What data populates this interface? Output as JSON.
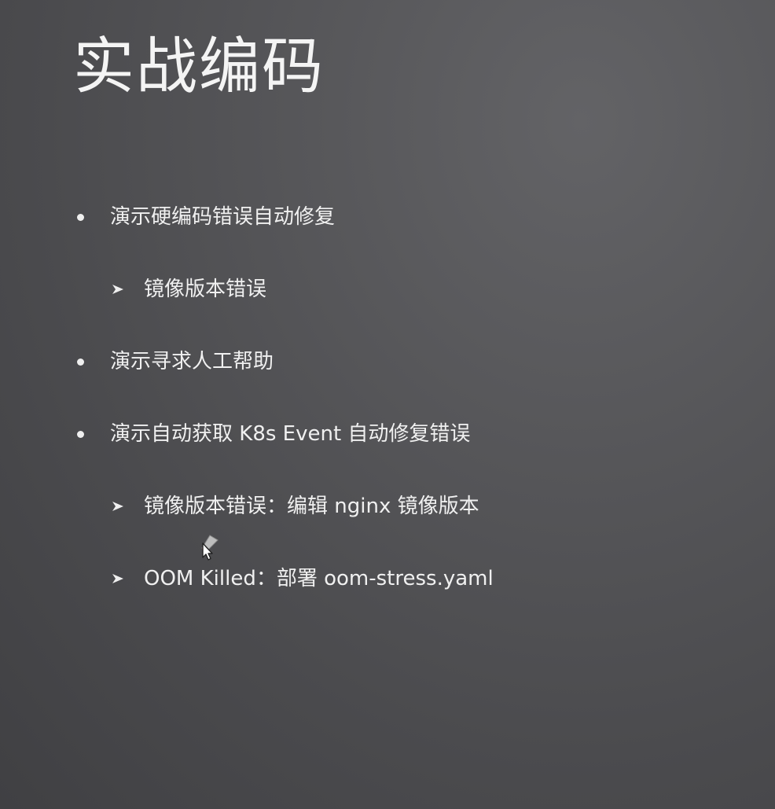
{
  "slide": {
    "title": "实战编码",
    "items": [
      {
        "level": 1,
        "text": "演示硬编码错误自动修复"
      },
      {
        "level": 2,
        "text": "镜像版本错误"
      },
      {
        "level": 1,
        "text": "演示寻求人工帮助"
      },
      {
        "level": 1,
        "text": "演示自动获取 K8s Event 自动修复错误"
      },
      {
        "level": 2,
        "text": "镜像版本错误：编辑 nginx 镜像版本"
      },
      {
        "level": 2,
        "text": "OOM Killed：部署 oom-stress.yaml"
      }
    ]
  },
  "icons": {
    "bullet": "bullet-dot-icon",
    "sub_bullet": "arrowhead-icon",
    "cursor": "mouse-pointer-icon"
  },
  "colors": {
    "background": "#4b4b4e",
    "text": "#f0f0f0"
  }
}
